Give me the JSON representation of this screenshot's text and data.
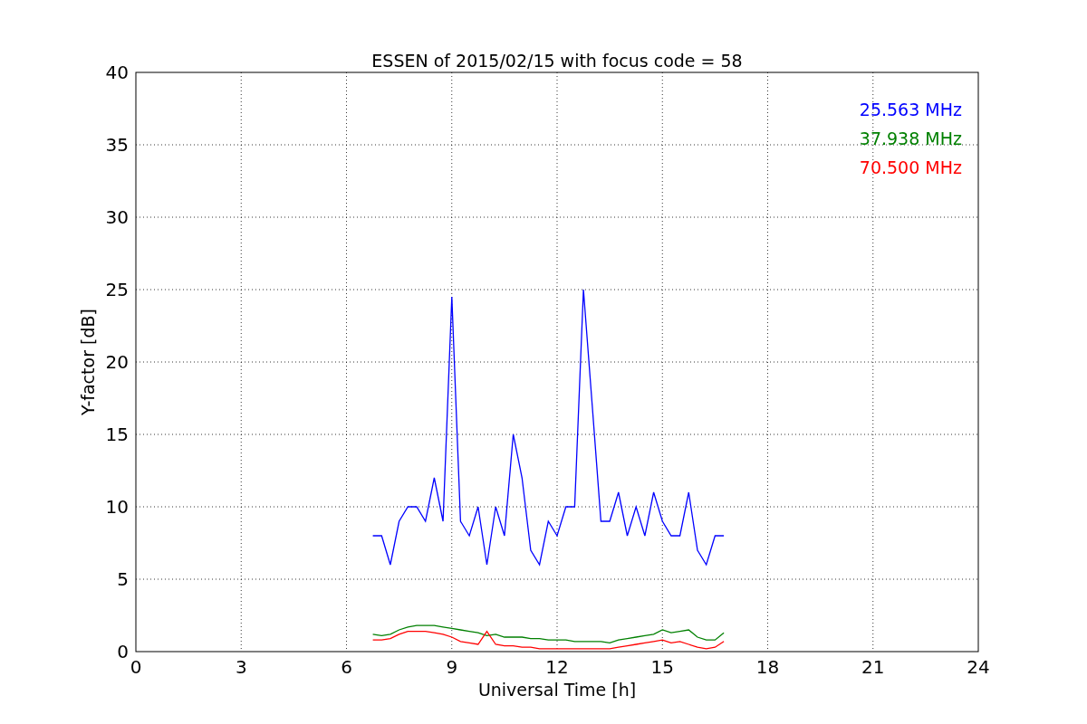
{
  "figure": {
    "chart_data": {
      "type": "line",
      "title": "ESSEN of 2015/02/15 with focus code = 58",
      "xlabel": "Universal Time [h]",
      "ylabel": "Y-factor [dB]",
      "x": [
        6.75,
        7,
        7.25,
        7.5,
        7.75,
        8,
        8.25,
        8.5,
        8.75,
        9,
        9.25,
        9.5,
        9.75,
        10,
        10.25,
        10.5,
        10.75,
        11,
        11.25,
        11.5,
        11.75,
        12,
        12.25,
        12.5,
        12.75,
        13,
        13.25,
        13.5,
        13.75,
        14,
        14.25,
        14.5,
        14.75,
        15,
        15.25,
        15.5,
        15.75,
        16,
        16.25,
        16.5,
        16.75
      ],
      "series": [
        {
          "name": "25.563 MHz",
          "color": "#0000ff",
          "values": [
            8,
            8,
            6,
            9,
            10,
            10,
            9,
            12,
            9,
            24.5,
            9,
            8,
            10,
            6,
            10,
            8,
            15,
            12,
            7,
            6,
            9,
            8,
            10,
            10,
            25,
            17,
            9,
            9,
            11,
            8,
            10,
            8,
            11,
            9,
            8,
            8,
            11,
            7,
            6,
            8,
            8
          ]
        },
        {
          "name": "37.938 MHz",
          "color": "#008000",
          "values": [
            1.2,
            1.1,
            1.2,
            1.5,
            1.7,
            1.8,
            1.8,
            1.8,
            1.7,
            1.6,
            1.5,
            1.4,
            1.3,
            1.1,
            1.2,
            1,
            1,
            1,
            0.9,
            0.9,
            0.8,
            0.8,
            0.8,
            0.7,
            0.7,
            0.7,
            0.7,
            0.6,
            0.8,
            0.9,
            1,
            1.1,
            1.2,
            1.5,
            1.3,
            1.4,
            1.5,
            1,
            0.8,
            0.8,
            1.3
          ]
        },
        {
          "name": "70.500 MHz",
          "color": "#ff0000",
          "values": [
            0.8,
            0.8,
            0.9,
            1.2,
            1.4,
            1.4,
            1.4,
            1.3,
            1.2,
            1,
            0.7,
            0.6,
            0.5,
            1.4,
            0.5,
            0.4,
            0.4,
            0.3,
            0.3,
            0.2,
            0.2,
            0.2,
            0.2,
            0.2,
            0.2,
            0.2,
            0.2,
            0.2,
            0.3,
            0.4,
            0.5,
            0.6,
            0.7,
            0.8,
            0.6,
            0.7,
            0.5,
            0.3,
            0.2,
            0.3,
            0.7
          ]
        }
      ],
      "grid": true,
      "xlim": [
        0,
        24
      ],
      "ylim": [
        0,
        40
      ],
      "xticks": [
        0,
        3,
        6,
        9,
        12,
        15,
        18,
        21,
        24
      ],
      "yticks": [
        0,
        5,
        10,
        15,
        20,
        25,
        30,
        35,
        40
      ]
    }
  }
}
